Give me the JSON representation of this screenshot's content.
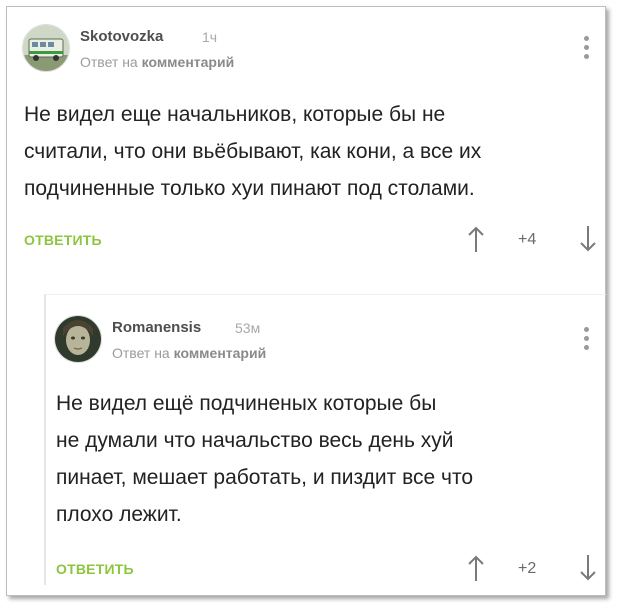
{
  "comments": [
    {
      "author": "Skotovozka",
      "time": "1ч",
      "reply_prefix": "Ответ на",
      "reply_target": "комментарий",
      "lines": [
        "Не видел еще начальников, которые бы не",
        "считали, что они вьёбывают, как кони, а все их",
        "подчиненные только хуи пинают под столами."
      ],
      "reply_label": "ОТВЕТИТЬ",
      "rating": "+4"
    },
    {
      "author": "Romanensis",
      "time": "53м",
      "reply_prefix": "Ответ на",
      "reply_target": "комментарий",
      "lines": [
        "Не видел ещё подчиненых которые бы",
        "не думали что начальство весь день хуй",
        "пинает, мешает работать, и пиздит все что",
        "плохо лежит."
      ],
      "reply_label": "ОТВЕТИТЬ",
      "rating": "+2"
    }
  ],
  "colors": {
    "accent_green": "#8cc63f",
    "meta_gray": "#a9a9a9",
    "text": "#222222"
  },
  "icons": {
    "upvote": "arrow-up-icon",
    "downvote": "arrow-down-icon",
    "menu": "vertical-dots-icon"
  }
}
